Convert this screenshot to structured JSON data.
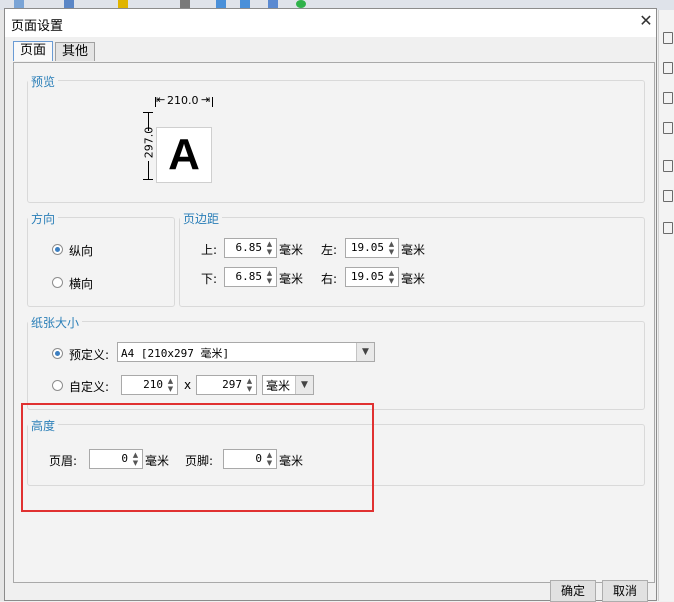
{
  "dialog": {
    "title": "页面设置"
  },
  "tabs": [
    {
      "label": "页面"
    },
    {
      "label": "其他"
    }
  ],
  "preview": {
    "label": "预览",
    "width_label": "210.0",
    "height_label": "297.0",
    "letter": "A"
  },
  "orientation": {
    "label": "方向",
    "options": [
      {
        "label": "纵向",
        "selected": true
      },
      {
        "label": "横向",
        "selected": false
      }
    ]
  },
  "margins": {
    "label": "页边距",
    "top_label": "上:",
    "top_value": "6.85",
    "left_label": "左:",
    "left_value": "19.05",
    "bottom_label": "下:",
    "bottom_value": "6.85",
    "right_label": "右:",
    "right_value": "19.05",
    "unit": "毫米"
  },
  "paper": {
    "label": "纸张大小",
    "predefined_label": "预定义:",
    "predefined_value": "A4 [210x297 毫米]",
    "custom_label": "自定义:",
    "custom_width": "210",
    "times": "x",
    "custom_height": "297",
    "custom_unit": "毫米"
  },
  "height": {
    "label": "高度",
    "header_label": "页眉:",
    "header_value": "0",
    "footer_label": "页脚:",
    "footer_value": "0",
    "unit": "毫米"
  },
  "buttons": {
    "ok": "确定",
    "cancel": "取消"
  },
  "colors": {
    "accent": "#2b7fb8",
    "highlight": "#e03131"
  },
  "icons": [
    "close-icon",
    "radio-icon",
    "spin-up-icon",
    "spin-down-icon",
    "chevron-down-icon"
  ]
}
